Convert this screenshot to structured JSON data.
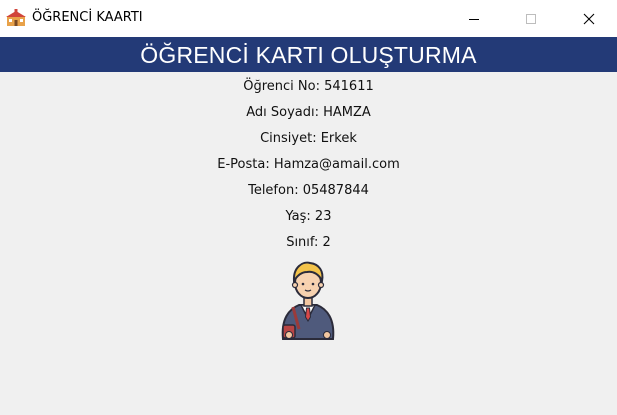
{
  "window": {
    "title": "ÖĞRENCİ KAARTI",
    "app_icon": "school-icon",
    "controls": [
      "minimize-icon",
      "maximize-icon",
      "close-icon"
    ]
  },
  "header": {
    "title": "ÖĞRENCİ KARTI OLUŞTURMA",
    "background": "#233a77",
    "color": "#ffffff"
  },
  "student": {
    "number": "Öğrenci No: 541611",
    "name": "Adı Soyadı: HAMZA",
    "gender": "Cinsiyet: Erkek",
    "email": "E-Posta: Hamza@amail.com",
    "phone": "Telefon: 05487844",
    "age": "Yaş: 23",
    "class": "Sınıf: 2"
  },
  "avatar": {
    "icon": "student-avatar-icon"
  }
}
